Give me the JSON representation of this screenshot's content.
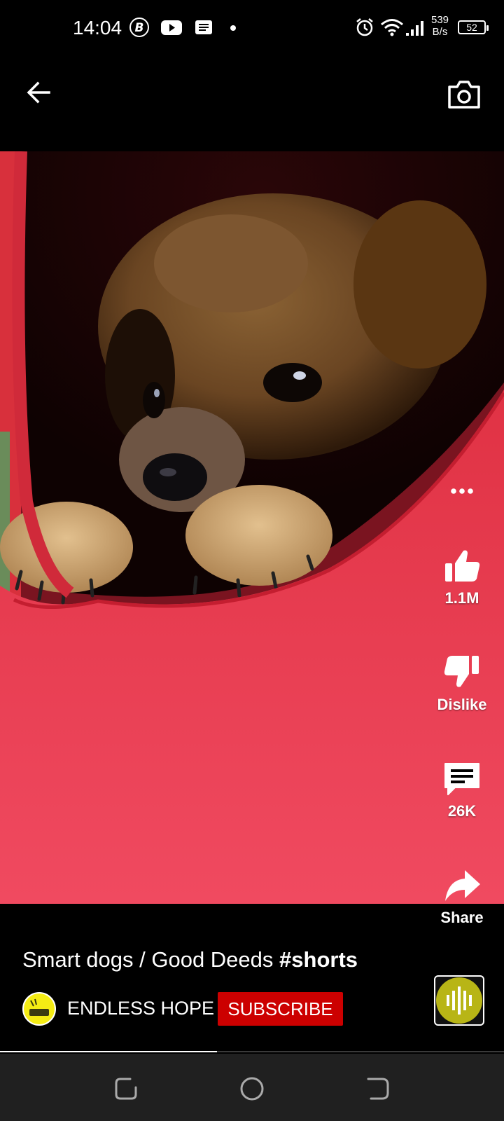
{
  "status_bar": {
    "time": "14:04",
    "net_speed_value": "539",
    "net_speed_unit": "B/s",
    "battery": "52",
    "icons": [
      "b-icon",
      "youtube-icon",
      "news-icon",
      "dot-icon",
      "alarm-icon",
      "wifi-icon",
      "signal-icon",
      "battery-icon"
    ]
  },
  "top_bar": {
    "back_icon": "arrow-left-icon",
    "camera_icon": "camera-icon"
  },
  "actions": {
    "more_icon": "more-horizontal-icon",
    "like_count": "1.1M",
    "dislike_label": "Dislike",
    "comment_count": "26K",
    "share_label": "Share"
  },
  "video": {
    "caption_text": "Smart dogs / Good Deeds ",
    "caption_tag": "#shorts",
    "channel_name": "ENDLESS HOPE",
    "subscribe_label": "SUBSCRIBE",
    "progress": 0.43
  },
  "nav_bar": {
    "icons": [
      "recents-icon",
      "home-icon",
      "back-icon"
    ]
  },
  "colors": {
    "subscribe_bg": "#cc0000",
    "avatar_bg": "#f4ec14",
    "video_bg": "#e8394d"
  }
}
